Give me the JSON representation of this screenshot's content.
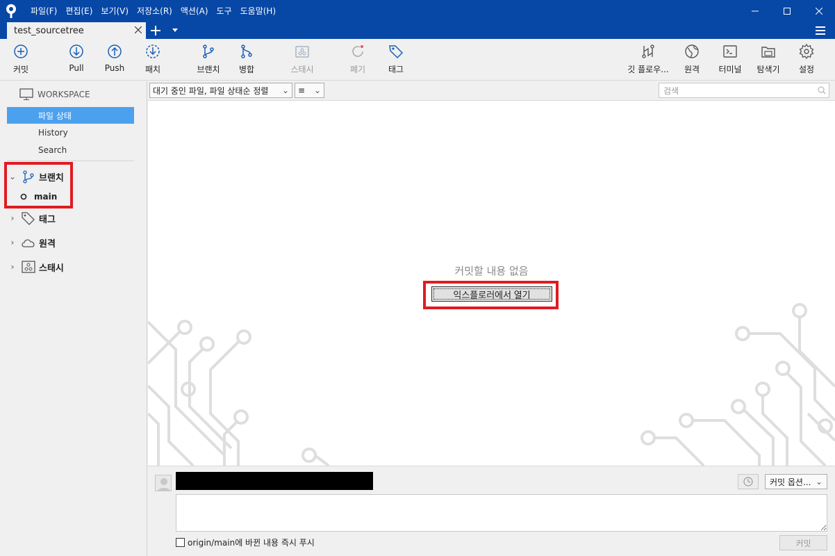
{
  "menu": [
    "파일(F)",
    "편집(E)",
    "보기(V)",
    "저장소(R)",
    "액션(A)",
    "도구",
    "도움말(H)"
  ],
  "tab": {
    "title": "test_sourcetree"
  },
  "toolbar": {
    "commit": "커밋",
    "pull": "Pull",
    "push": "Push",
    "patch": "패치",
    "branch": "브랜치",
    "merge": "병합",
    "stash": "스태시",
    "discard": "폐기",
    "tag": "태그",
    "gitflow": "깃 플로우...",
    "remote": "원격",
    "terminal": "터미널",
    "explorer": "탐색기",
    "settings": "설정"
  },
  "sidebar": {
    "workspace": "WORKSPACE",
    "items": [
      "파일 상태",
      "History",
      "Search"
    ],
    "branches": "브랜치",
    "branch_main": "main",
    "tags": "태그",
    "remotes": "원격",
    "stashes": "스태시"
  },
  "filter": {
    "sort": "대기 중인 파일, 파일 상태순 정렬",
    "view_icon": "≡",
    "search_placeholder": "검색"
  },
  "main": {
    "empty_message": "커밋할 내용 없음",
    "open_explorer": "익스플로러에서 열기"
  },
  "commit_area": {
    "options": "커밋 옵션...",
    "push_label": "origin/main에 바뀐 내용 즉시 푸시",
    "commit_button": "커밋"
  },
  "colors": {
    "brand": "#0747a6",
    "selection": "#4ca1ef",
    "highlight_box": "#e11b22"
  }
}
